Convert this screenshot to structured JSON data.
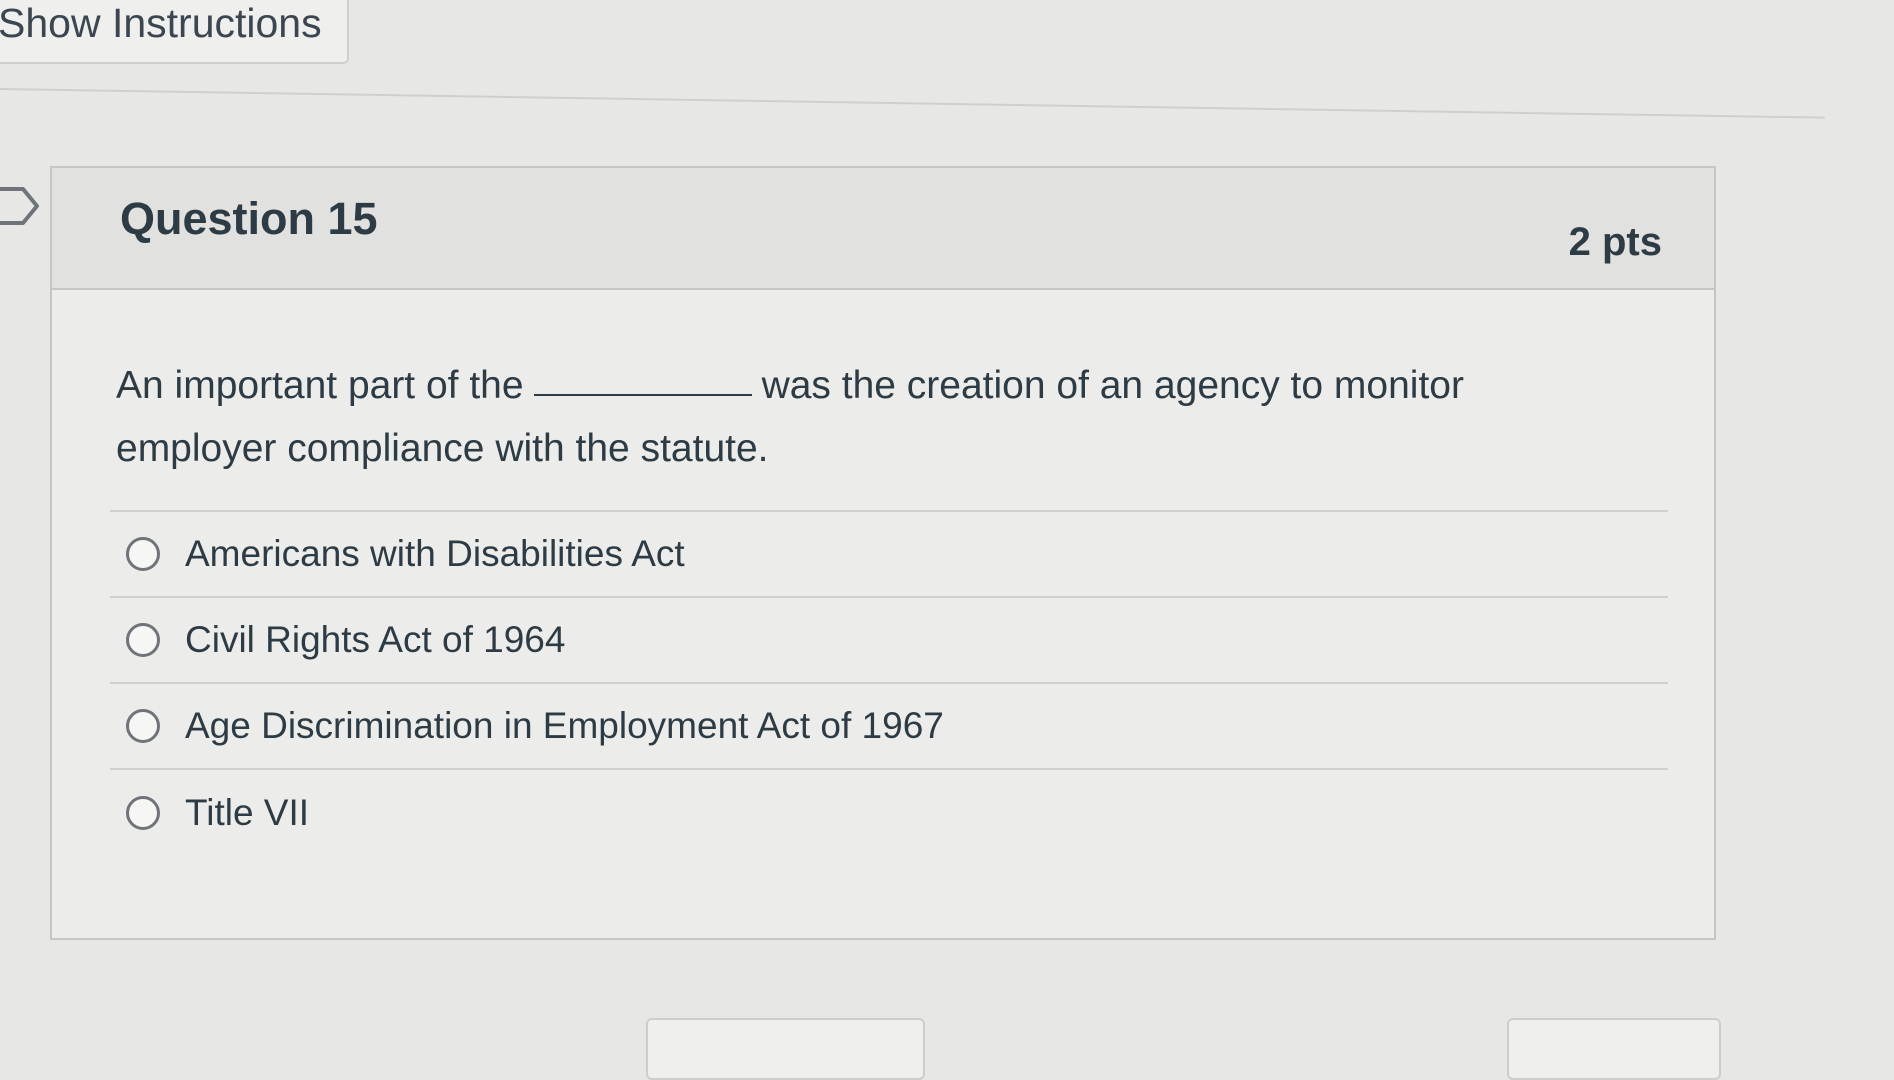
{
  "top": {
    "show_instructions_label": "Show Instructions"
  },
  "question": {
    "title": "Question 15",
    "points": "2 pts",
    "text_before_blank": "An important part of the",
    "text_after_blank": "was the creation of an agency to monitor employer compliance with the statute.",
    "options": [
      "Americans with Disabilities Act",
      "Civil Rights Act of 1964",
      "Age Discrimination in Employment Act of 1967",
      "Title VII"
    ]
  },
  "icons": {
    "flag": "flag-icon",
    "radio": "radio-unchecked-icon"
  },
  "colors": {
    "page_background": "#e7e7e5",
    "card_background": "#ececea",
    "header_background": "#e1e1df",
    "text": "#2d3b45",
    "border": "#c6c7c5"
  }
}
